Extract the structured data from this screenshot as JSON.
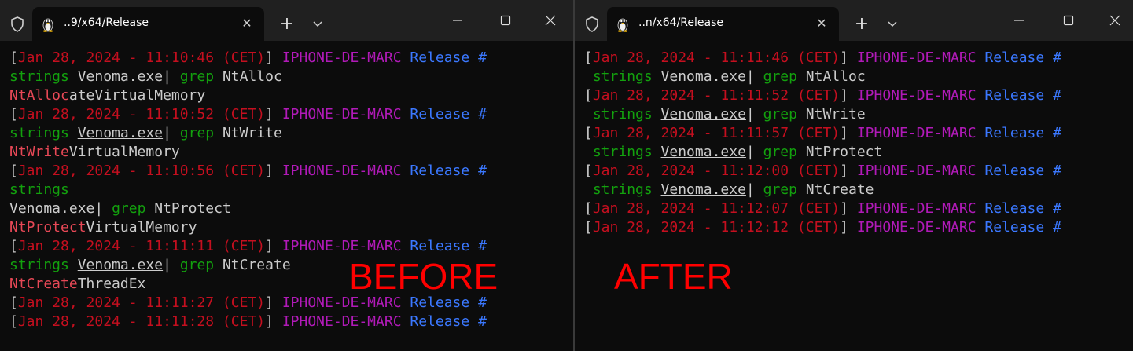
{
  "left_window": {
    "tab_title": "..9/x64/Release",
    "label": "BEFORE",
    "lines": [
      {
        "t": "prompt",
        "date": "Jan 28, 2024 - 11:10:46 (CET)"
      },
      {
        "t": "cmd",
        "lead": "",
        "cmd": "strings",
        "file": "Venoma.exe",
        "pipe": "| ",
        "grep": "grep",
        "arg": " NtAlloc"
      },
      {
        "t": "out",
        "match": "NtAlloc",
        "rest": "ateVirtualMemory"
      },
      {
        "t": "prompt",
        "date": "Jan 28, 2024 - 11:10:52 (CET)"
      },
      {
        "t": "cmd",
        "lead": "",
        "cmd": "strings",
        "file": "Venoma.exe",
        "pipe": "| ",
        "grep": "grep",
        "arg": " NtWrite"
      },
      {
        "t": "out",
        "match": "NtWrite",
        "rest": "VirtualMemory"
      },
      {
        "t": "prompt",
        "date": "Jan 28, 2024 - 11:10:56 (CET)"
      },
      {
        "t": "cmdonly",
        "cmd": "strings"
      },
      {
        "t": "cmdtail",
        "file": "Venoma.exe",
        "pipe": "| ",
        "grep": "grep",
        "arg": " NtProtect"
      },
      {
        "t": "out",
        "match": "NtProtect",
        "rest": "VirtualMemory"
      },
      {
        "t": "prompt",
        "date": "Jan 28, 2024 - 11:11:11 (CET)"
      },
      {
        "t": "cmd",
        "lead": "",
        "cmd": "strings",
        "file": "Venoma.exe",
        "pipe": "| ",
        "grep": "grep",
        "arg": " NtCreate"
      },
      {
        "t": "out",
        "match": "NtCreate",
        "rest": "ThreadEx"
      },
      {
        "t": "prompt",
        "date": "Jan 28, 2024 - 11:11:27 (CET)"
      },
      {
        "t": "prompt",
        "date": "Jan 28, 2024 - 11:11:28 (CET)"
      }
    ]
  },
  "right_window": {
    "tab_title": "..n/x64/Release",
    "label": "AFTER",
    "lines": [
      {
        "t": "prompt",
        "date": "Jan 28, 2024 - 11:11:46 (CET)"
      },
      {
        "t": "cmd",
        "lead": " ",
        "cmd": "strings",
        "file": "Venoma.exe",
        "pipe": "| ",
        "grep": "grep",
        "arg": " NtAlloc"
      },
      {
        "t": "prompt",
        "date": "Jan 28, 2024 - 11:11:52 (CET)"
      },
      {
        "t": "cmd",
        "lead": " ",
        "cmd": "strings",
        "file": "Venoma.exe",
        "pipe": "| ",
        "grep": "grep",
        "arg": " NtWrite"
      },
      {
        "t": "prompt",
        "date": "Jan 28, 2024 - 11:11:57 (CET)"
      },
      {
        "t": "cmd",
        "lead": " ",
        "cmd": "strings",
        "file": "Venoma.exe",
        "pipe": "| ",
        "grep": "grep",
        "arg": " NtProtect"
      },
      {
        "t": "prompt",
        "date": "Jan 28, 2024 - 11:12:00 (CET)"
      },
      {
        "t": "cmd",
        "lead": " ",
        "cmd": "strings",
        "file": "Venoma.exe",
        "pipe": "| ",
        "grep": "grep",
        "arg": " NtCreate"
      },
      {
        "t": "prompt",
        "date": "Jan 28, 2024 - 11:12:07 (CET)"
      },
      {
        "t": "prompt",
        "date": "Jan 28, 2024 - 11:12:12 (CET)"
      }
    ]
  },
  "prompt": {
    "open": "[",
    "close": "]",
    "host": "IPHONE-DE-MARC",
    "dir": "Release",
    "symbol": "#"
  },
  "icons": {
    "shield": "shield-icon",
    "tab": "linux-penguin-icon",
    "close": "close-icon",
    "new_tab": "plus-icon",
    "dropdown": "chevron-down-icon",
    "minimize": "minimize-icon",
    "maximize": "maximize-icon",
    "window_close": "window-close-icon"
  },
  "colors": {
    "date": "#c50f1f",
    "host": "#b11ab8",
    "dir": "#3b78ff",
    "command": "#13a10e",
    "match": "#e74856",
    "label": "#ff0000"
  }
}
